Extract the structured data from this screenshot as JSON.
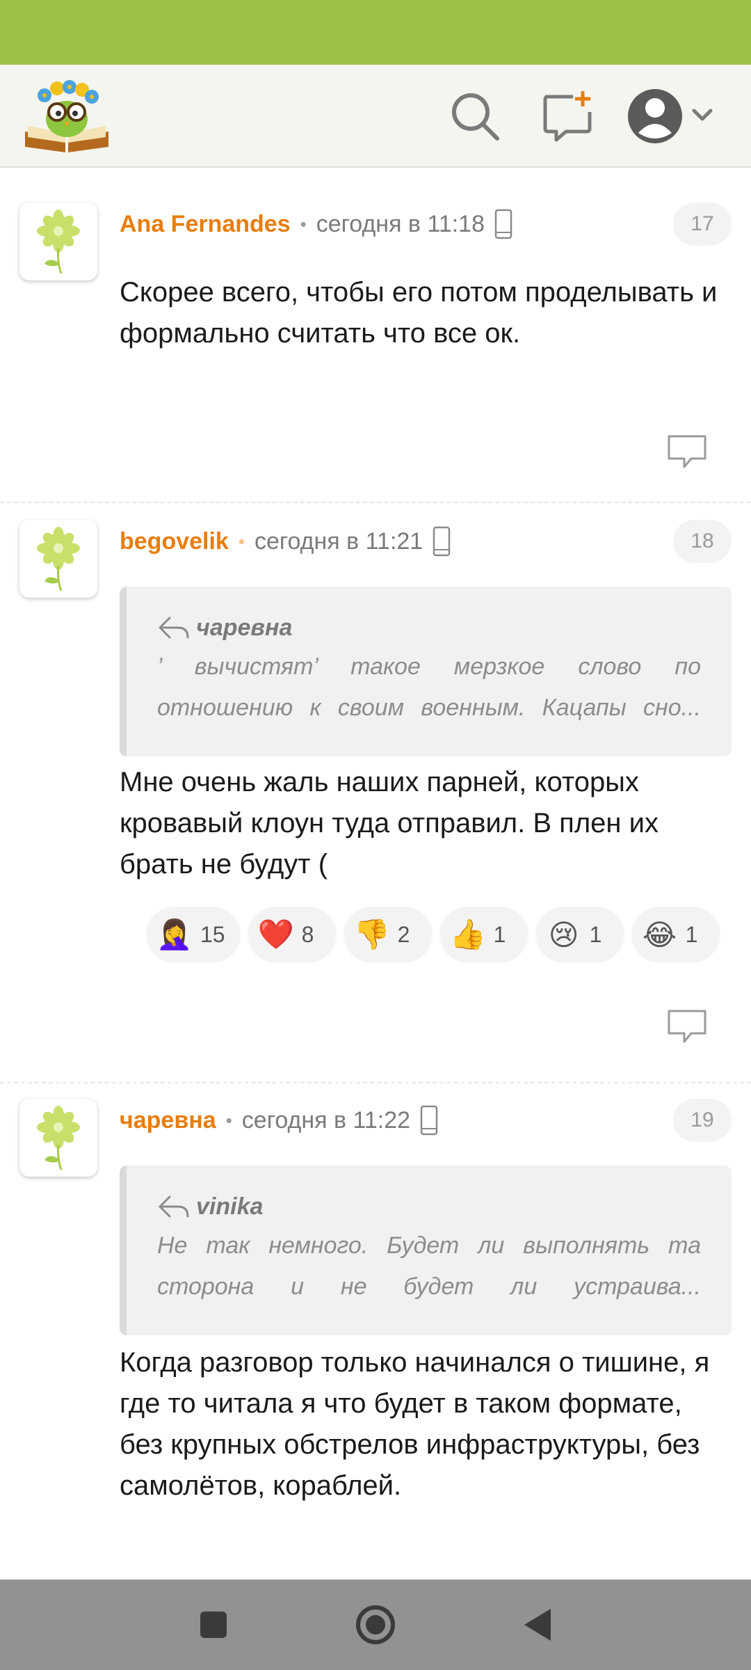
{
  "header": {
    "logo": "book-owl-logo",
    "icons": [
      "search-icon",
      "new-post-icon",
      "user-avatar-icon",
      "chevron-down-icon"
    ]
  },
  "comments": [
    {
      "author": "Ana Fernandes",
      "time": "сегодня в 11:18",
      "number": "17",
      "text": "Скорее всего, чтобы его потом проделывать и формально считать что все ок."
    },
    {
      "author": "begovelik",
      "time": "сегодня в 11:21",
      "number": "18",
      "quote_author": "чаревна",
      "quote_text": "’ вычистят’ такое мерзкое слово по отношению к своим военным. Кацапы сно...",
      "text": "Мне очень жаль наших парней, которых кровавый клоун туда отправил. В плен их брать не будут (",
      "reactions": [
        {
          "emoji": "🤦‍♀️",
          "count": "15"
        },
        {
          "emoji": "❤️",
          "count": "8"
        },
        {
          "emoji": "👎",
          "count": "2"
        },
        {
          "emoji": "👍",
          "count": "1"
        },
        {
          "emoji": "😢",
          "count": "1"
        },
        {
          "emoji": "😂",
          "count": "1"
        }
      ]
    },
    {
      "author": "чаревна",
      "time": "сегодня в 11:22",
      "number": "19",
      "quote_author": "vinika",
      "quote_text": "Не так немного. Будет ли выполнять та сторона и не будет ли устраива...",
      "text": "Когда разговор только начинался о тишине, я где то читала я что будет в таком формате, без крупных обстрелов инфраструктуры, без самолётов, кораблей."
    }
  ],
  "navbar": {
    "buttons": [
      "recent-apps-button",
      "home-button",
      "back-button"
    ]
  },
  "colors": {
    "status_bar": "#9dc144",
    "author": "#e87d0d",
    "header_bg": "#f5f5ef"
  }
}
